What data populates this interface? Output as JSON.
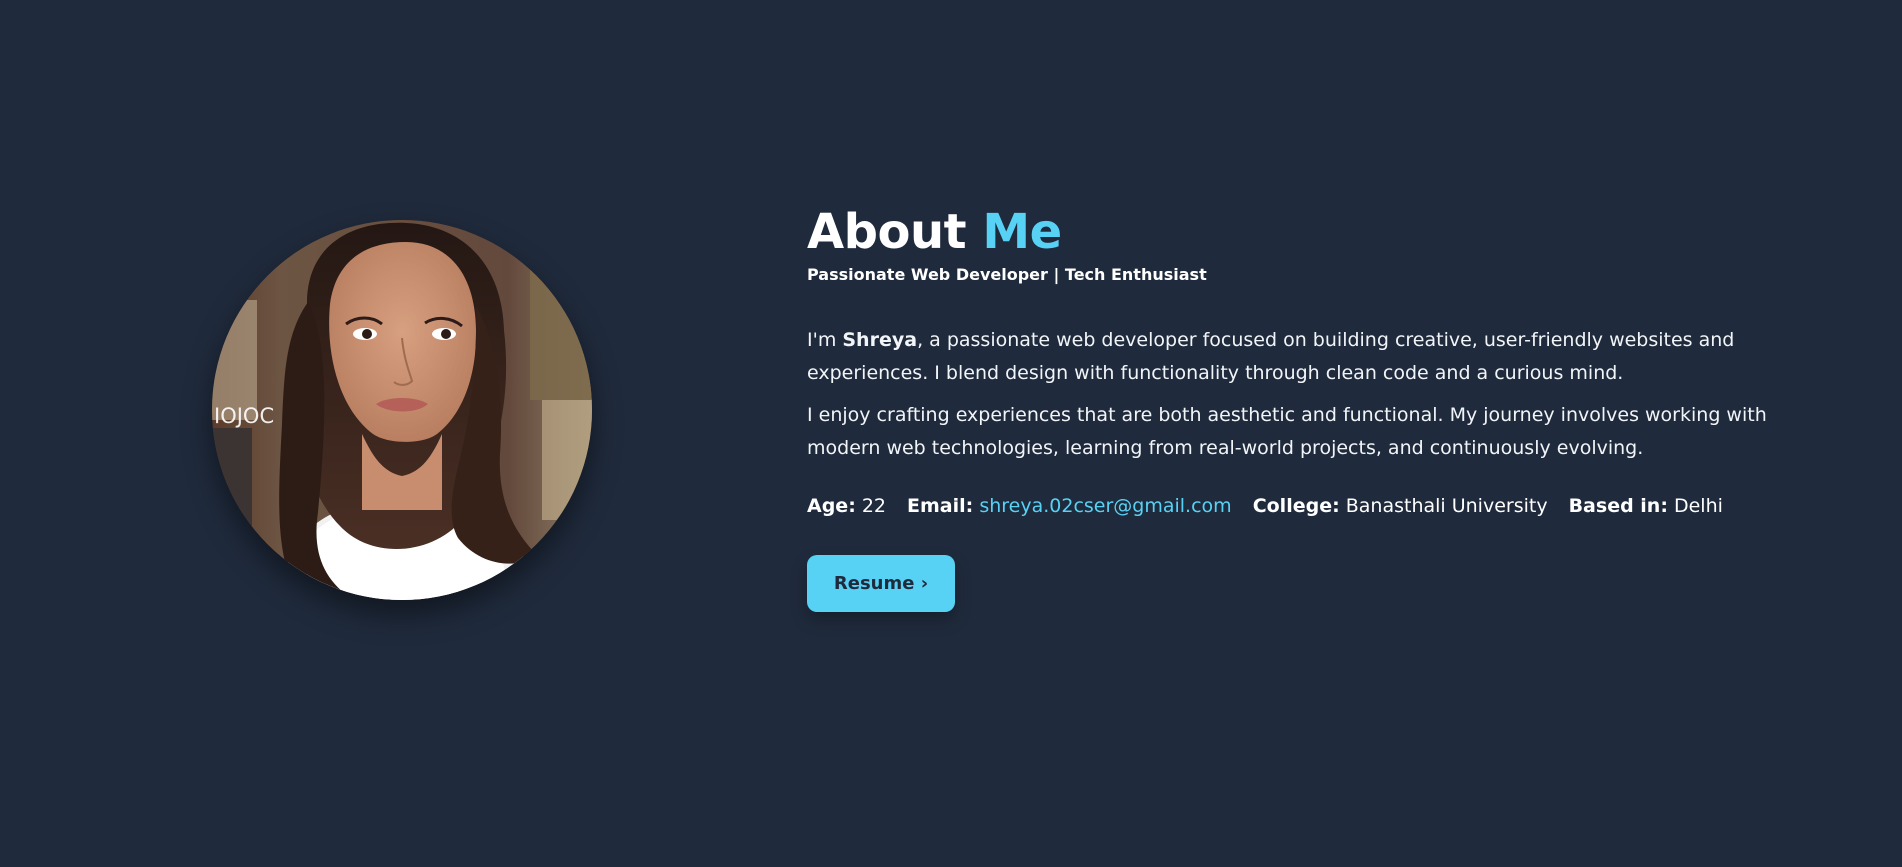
{
  "about": {
    "title_main": "About ",
    "title_accent": "Me",
    "subtitle": "Passionate Web Developer | Tech Enthusiast",
    "bio_paragraph_1": {
      "prefix": "I'm ",
      "name": "Shreya",
      "suffix": ", a passionate web developer focused on building creative, user-friendly websites and experiences. I blend design with functionality through clean code and a curious mind."
    },
    "bio_paragraph_2": "I enjoy crafting experiences that are both aesthetic and functional. My journey involves working with modern web technologies, learning from real-world projects, and continuously evolving."
  },
  "info": {
    "age_label": "Age:",
    "age_value": "22",
    "email_label": "Email:",
    "email_value": "shreya.02cser@gmail.com",
    "college_label": "College:",
    "college_value": "Banasthali University",
    "location_label": "Based in:",
    "location_value": "Delhi"
  },
  "resume_button": {
    "label": "Resume ›"
  },
  "colors": {
    "background": "#1f2a3c",
    "accent": "#58d2f4",
    "text": "#ffffff"
  },
  "icons": {
    "profile_photo": "portrait-photo"
  }
}
